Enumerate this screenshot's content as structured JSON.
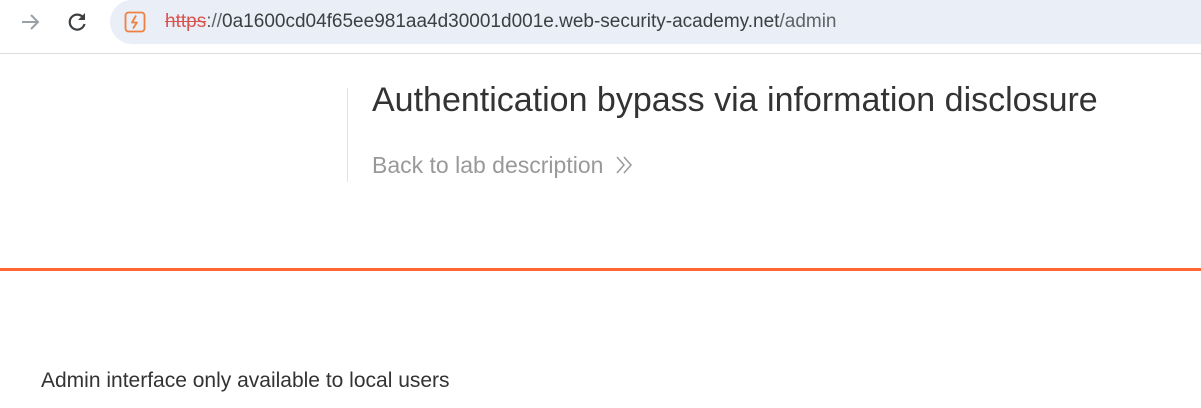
{
  "browser": {
    "url_scheme": "https",
    "url_separator": "://",
    "url_host": "0a1600cd04f65ee981aa4d30001d001e.web-security-academy.net",
    "url_path": "/admin",
    "icons": {
      "forward": "forward-arrow-icon",
      "reload": "reload-icon",
      "site": "site-warning-icon"
    }
  },
  "lab": {
    "title": "Authentication bypass via information disclosure",
    "back_link": "Back to lab description",
    "accent_color": "#ff6633"
  },
  "main": {
    "message": "Admin interface only available to local users"
  }
}
